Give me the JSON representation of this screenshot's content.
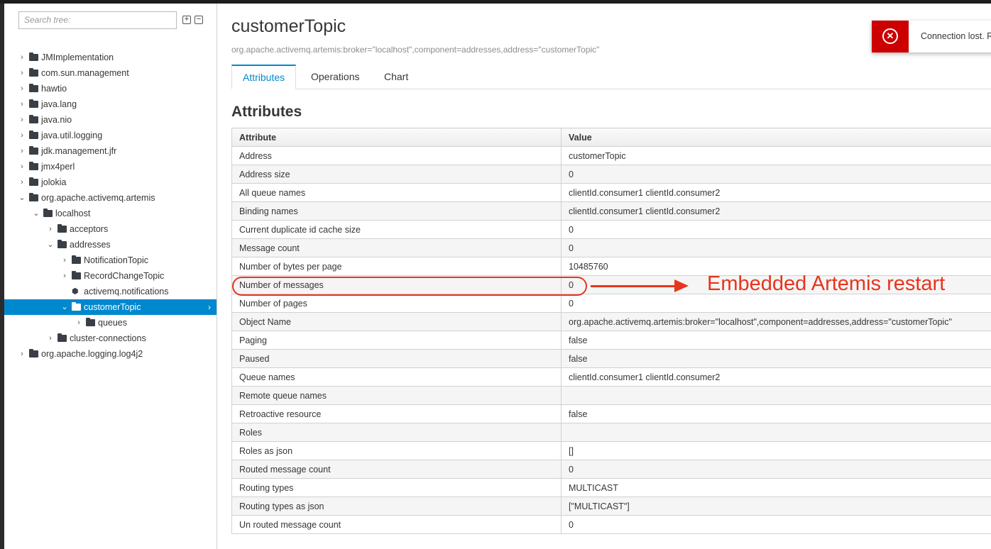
{
  "sidebar": {
    "search_placeholder": "Search tree:",
    "expand_all_glyph": "+",
    "collapse_all_glyph": "−",
    "nodes": [
      {
        "label": "JMImplementation",
        "chevron": "›",
        "icon": "folder-icon"
      },
      {
        "label": "com.sun.management",
        "chevron": "›",
        "icon": "folder-icon"
      },
      {
        "label": "hawtio",
        "chevron": "›",
        "icon": "folder-icon"
      },
      {
        "label": "java.lang",
        "chevron": "›",
        "icon": "folder-icon"
      },
      {
        "label": "java.nio",
        "chevron": "›",
        "icon": "folder-icon"
      },
      {
        "label": "java.util.logging",
        "chevron": "›",
        "icon": "folder-icon"
      },
      {
        "label": "jdk.management.jfr",
        "chevron": "›",
        "icon": "folder-icon"
      },
      {
        "label": "jmx4perl",
        "chevron": "›",
        "icon": "folder-icon"
      },
      {
        "label": "jolokia",
        "chevron": "›",
        "icon": "folder-icon"
      },
      {
        "label": "org.apache.activemq.artemis",
        "chevron": "⌄",
        "icon": "folder-icon"
      },
      {
        "label": "localhost",
        "chevron": "⌄",
        "icon": "folder-icon"
      },
      {
        "label": "acceptors",
        "chevron": "›",
        "icon": "folder-icon"
      },
      {
        "label": "addresses",
        "chevron": "⌄",
        "icon": "folder-icon"
      },
      {
        "label": "NotificationTopic",
        "chevron": "›",
        "icon": "folder-icon"
      },
      {
        "label": "RecordChangeTopic",
        "chevron": "›",
        "icon": "folder-icon"
      },
      {
        "label": "activemq.notifications",
        "chevron": "",
        "icon": "cube-icon"
      },
      {
        "label": "customerTopic",
        "chevron": "⌄",
        "icon": "folder-icon",
        "selected": true
      },
      {
        "label": "queues",
        "chevron": "›",
        "icon": "folder-icon"
      },
      {
        "label": "cluster-connections",
        "chevron": "›",
        "icon": "folder-icon"
      },
      {
        "label": "org.apache.logging.log4j2",
        "chevron": "›",
        "icon": "folder-icon"
      }
    ]
  },
  "main": {
    "title": "customerTopic",
    "mbean_name": "org.apache.activemq.artemis:broker=\"localhost\",component=addresses,address=\"customerTopic\"",
    "tabs": [
      {
        "label": "Attributes",
        "active": true
      },
      {
        "label": "Operations",
        "active": false
      },
      {
        "label": "Chart",
        "active": false
      }
    ],
    "section_title": "Attributes",
    "table": {
      "headers": [
        "Attribute",
        "Value"
      ],
      "rows": [
        [
          "Address",
          "customerTopic"
        ],
        [
          "Address size",
          "0"
        ],
        [
          "All queue names",
          "clientId.consumer1 clientId.consumer2"
        ],
        [
          "Binding names",
          "clientId.consumer1 clientId.consumer2"
        ],
        [
          "Current duplicate id cache size",
          "0"
        ],
        [
          "Message count",
          "0"
        ],
        [
          "Number of bytes per page",
          "10485760"
        ],
        [
          "Number of messages",
          "0"
        ],
        [
          "Number of pages",
          "0"
        ],
        [
          "Object Name",
          "org.apache.activemq.artemis:broker=\"localhost\",component=addresses,address=\"customerTopic\""
        ],
        [
          "Paging",
          "false"
        ],
        [
          "Paused",
          "false"
        ],
        [
          "Queue names",
          "clientId.consumer1 clientId.consumer2"
        ],
        [
          "Remote queue names",
          ""
        ],
        [
          "Retroactive resource",
          "false"
        ],
        [
          "Roles",
          ""
        ],
        [
          "Roles as json",
          "[]"
        ],
        [
          "Routed message count",
          "0"
        ],
        [
          "Routing types",
          "MULTICAST"
        ],
        [
          "Routing types as json",
          "[\"MULTICAST\"]"
        ],
        [
          "Un routed message count",
          "0"
        ]
      ]
    }
  },
  "toast": {
    "message": "Connection lost. R",
    "icon": "error-circle-icon",
    "glyph": "✕",
    "color": "#cc0000"
  },
  "annotation": {
    "text": "Embedded Artemis restart",
    "color": "#e8351d"
  },
  "colors": {
    "accent": "#0088ce"
  }
}
